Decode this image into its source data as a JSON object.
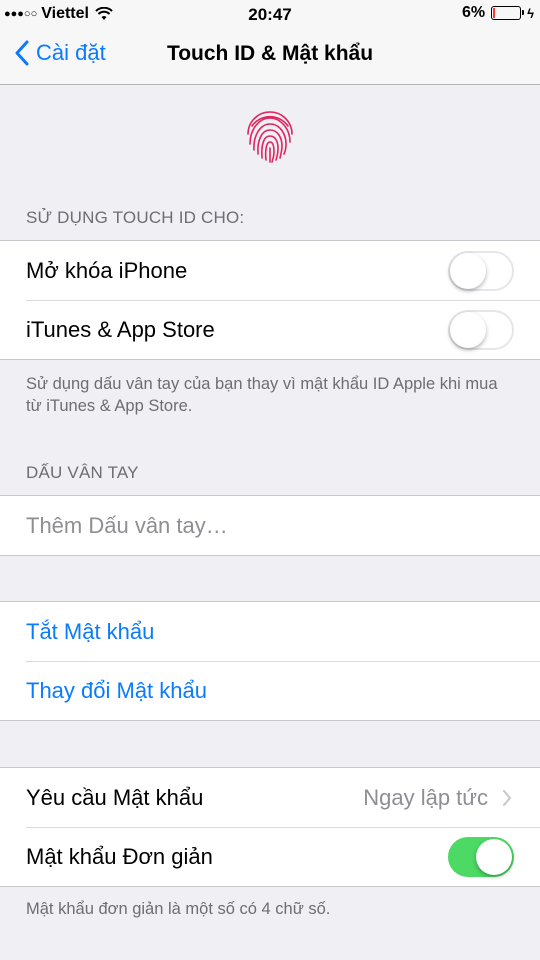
{
  "status_bar": {
    "carrier": "Viettel",
    "signal_dots": "●●●○○",
    "time": "20:47",
    "battery_percent": "6%",
    "battery_level": 0.06,
    "icons": [
      "wifi-icon",
      "battery-icon",
      "charging-bolt-icon"
    ]
  },
  "nav": {
    "back_label": "Cài đặt",
    "title": "Touch ID & Mật khẩu"
  },
  "fingerprint_icon": {
    "name": "fingerprint-icon",
    "color": "#e0245e"
  },
  "sections": {
    "use_touch_id": {
      "header": "SỬ DỤNG TOUCH ID CHO:",
      "items": [
        {
          "label": "Mở khóa iPhone",
          "toggle_on": false
        },
        {
          "label": "iTunes & App Store",
          "toggle_on": false
        }
      ],
      "footer": "Sử dụng dấu vân tay của bạn thay vì mật khẩu ID Apple khi mua từ iTunes & App Store."
    },
    "fingerprints": {
      "header": "DẤU VÂN TAY",
      "add_label": "Thêm Dấu vân tay…"
    },
    "passcode": {
      "turn_off_label": "Tắt Mật khẩu",
      "change_label": "Thay đổi Mật khẩu"
    },
    "require": {
      "require_label": "Yêu cầu Mật khẩu",
      "require_value": "Ngay lập tức",
      "simple_label": "Mật khẩu Đơn giản",
      "simple_on": true,
      "footer": "Mật khẩu đơn giản là một số có 4 chữ số."
    }
  },
  "colors": {
    "accent": "#0a7bff",
    "toggle_on": "#4cd964",
    "background": "#efeff4"
  }
}
